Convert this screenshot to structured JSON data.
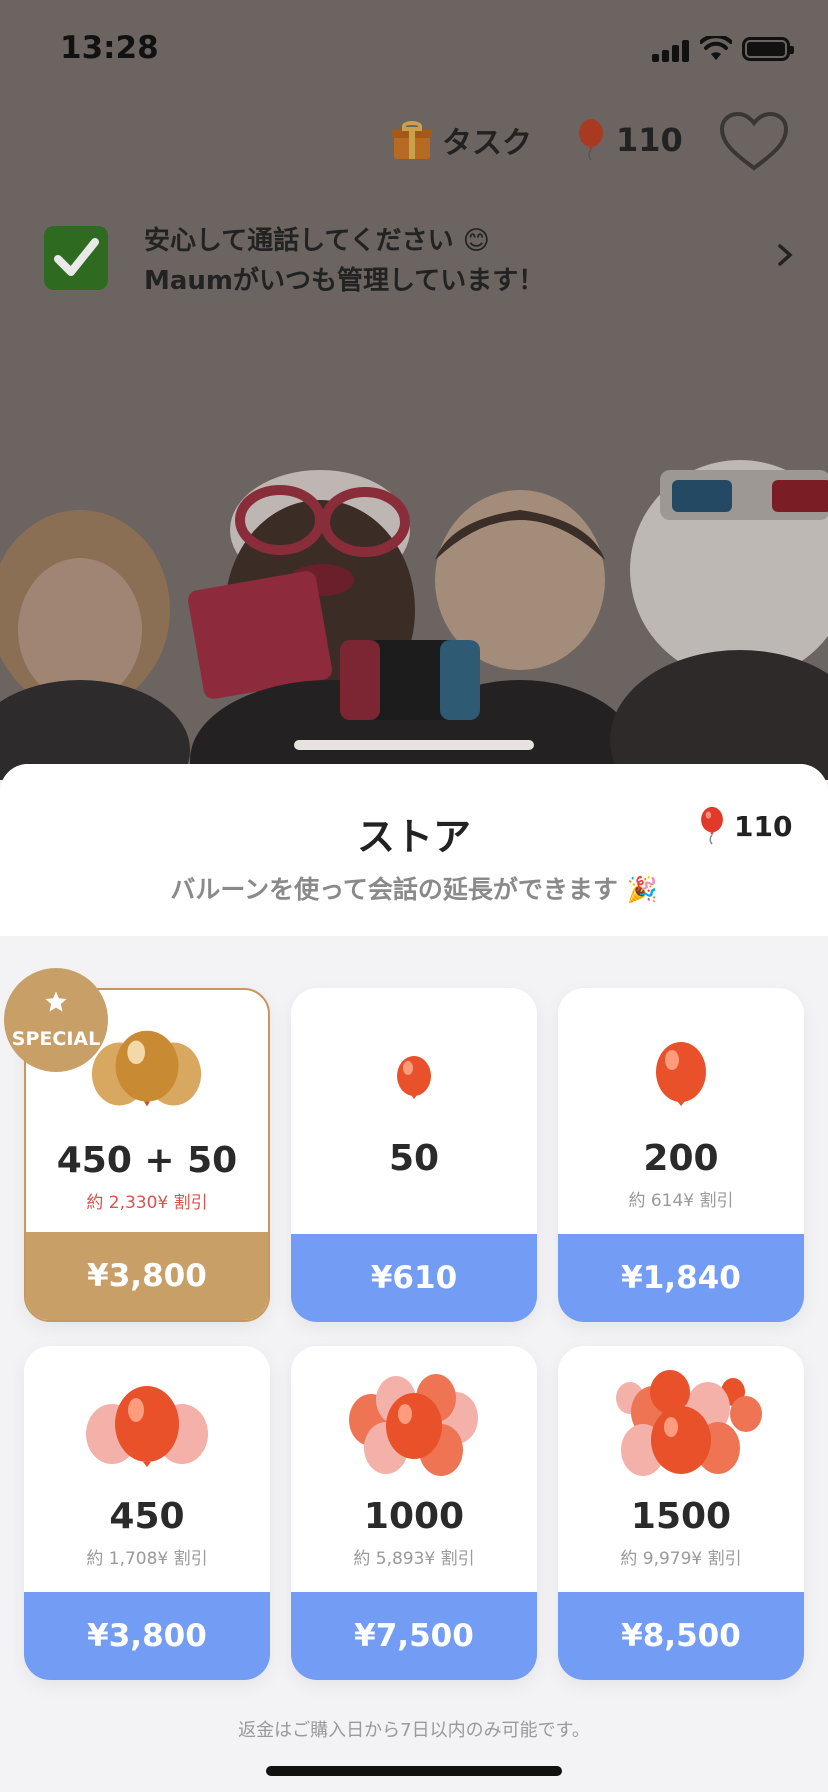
{
  "status_bar": {
    "time": "13:28"
  },
  "header": {
    "task_label": "タスク",
    "balloon_count": "110"
  },
  "notice": {
    "line1": "安心して通話してください 😊",
    "line2": "Maumがいつも管理しています！"
  },
  "store": {
    "title": "ストア",
    "balance": "110",
    "subtitle": "バルーンを使って会話の延長ができます 🎉",
    "special_label": "SPECIAL",
    "refund_note": "返金はご購入日から7日以内のみ可能です。",
    "packages": [
      {
        "amount": "450 + 50",
        "discount": "約 2,330¥ 割引",
        "price": "¥3,800",
        "special": true
      },
      {
        "amount": "50",
        "discount": "",
        "price": "¥610",
        "special": false
      },
      {
        "amount": "200",
        "discount": "約 614¥ 割引",
        "price": "¥1,840",
        "special": false
      },
      {
        "amount": "450",
        "discount": "約 1,708¥ 割引",
        "price": "¥3,800",
        "special": false
      },
      {
        "amount": "1000",
        "discount": "約 5,893¥ 割引",
        "price": "¥7,500",
        "special": false
      },
      {
        "amount": "1500",
        "discount": "約 9,979¥ 割引",
        "price": "¥8,500",
        "special": false
      }
    ]
  },
  "colors": {
    "accent_blue": "#739cf5",
    "special_gold": "#c89f66",
    "balloon_red": "#e8512a",
    "discount_red": "#d9534f"
  }
}
